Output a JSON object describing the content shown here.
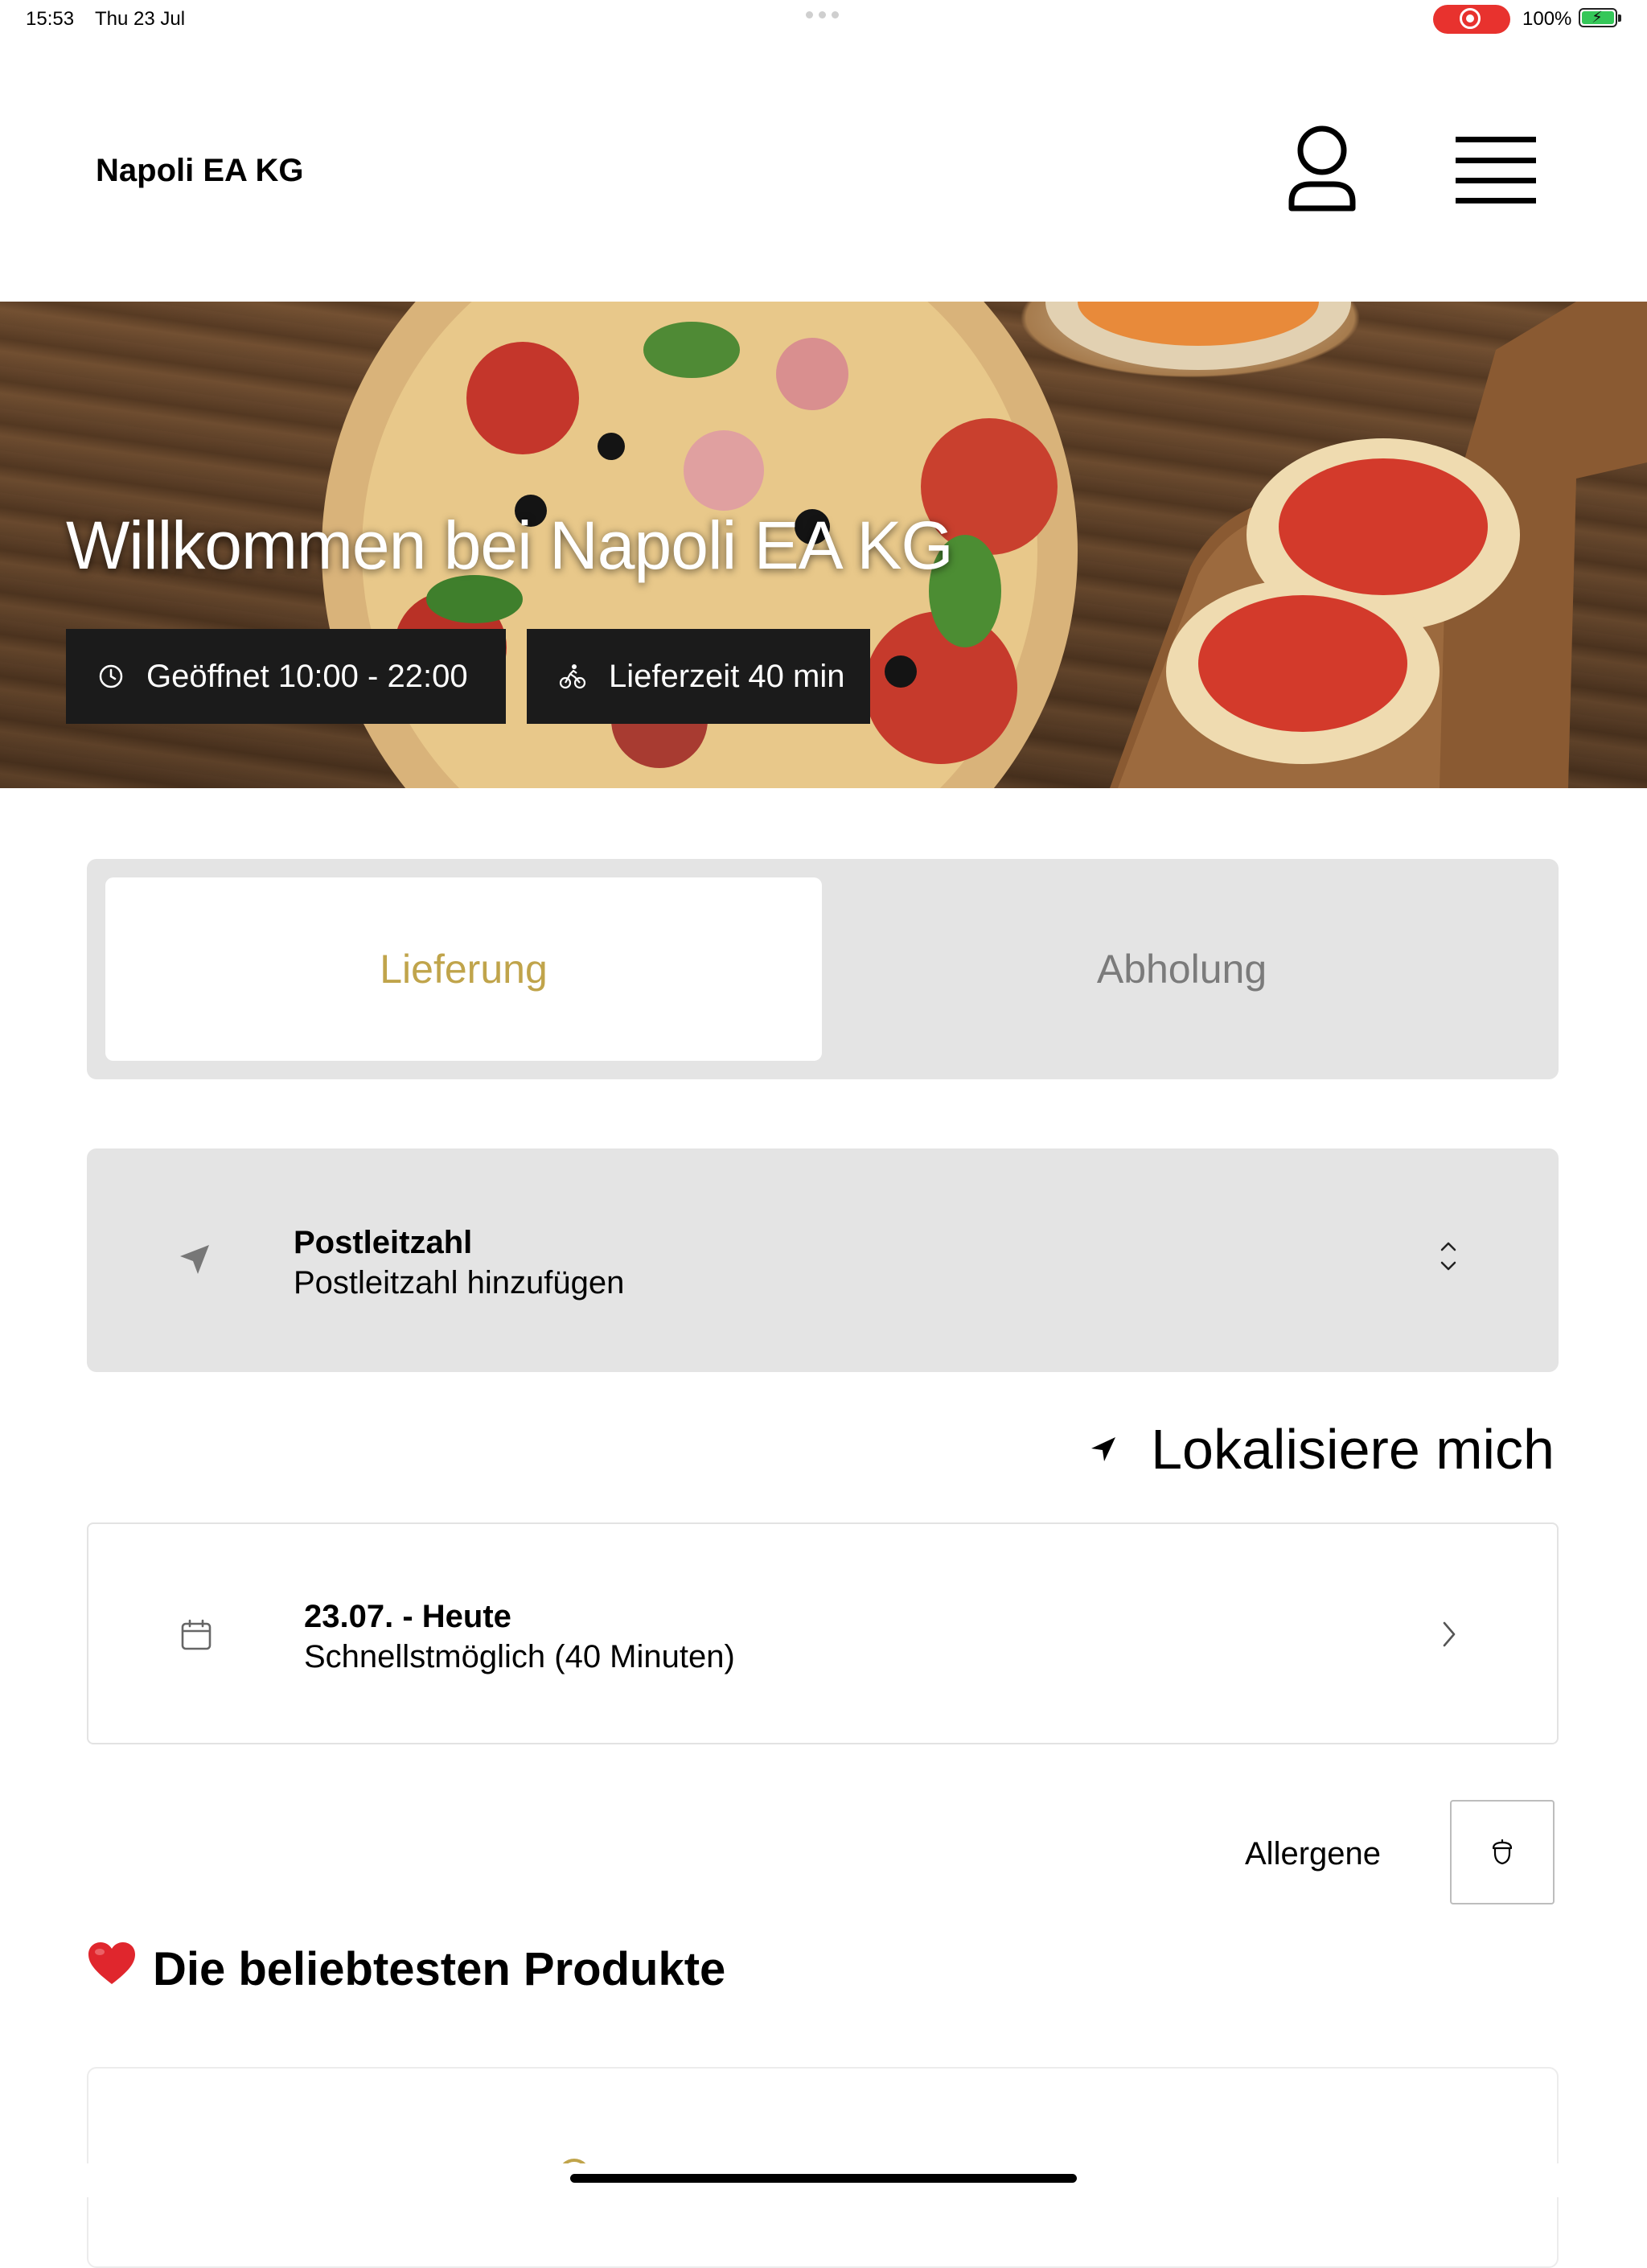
{
  "status_bar": {
    "time": "15:53",
    "date": "Thu 23 Jul",
    "battery": "100%",
    "recording_color": "#e8322e"
  },
  "header": {
    "brand": "Napoli EA KG",
    "account_icon": "person-icon",
    "menu_icon": "hamburger-menu-icon"
  },
  "hero": {
    "title": "Willkommen bei Napoli EA KG",
    "opening_hours": "Geöffnet 10:00 - 22:00",
    "delivery_time": "Lieferzeit 40 min"
  },
  "order_mode": {
    "options": [
      "Lieferung",
      "Abholung"
    ],
    "selected": "Lieferung",
    "accent_color": "#c0a44b"
  },
  "postal_code": {
    "label": "Postleitzahl",
    "placeholder": "Postleitzahl hinzufügen"
  },
  "locate": {
    "label": "Lokalisiere mich"
  },
  "schedule": {
    "date": "23.07. - Heute",
    "time": "Schnellstmöglich (40 Minuten)"
  },
  "allergens": {
    "label": "Allergene"
  },
  "popular": {
    "emoji": "❤️",
    "title": "Die beliebtesten Produkte"
  }
}
